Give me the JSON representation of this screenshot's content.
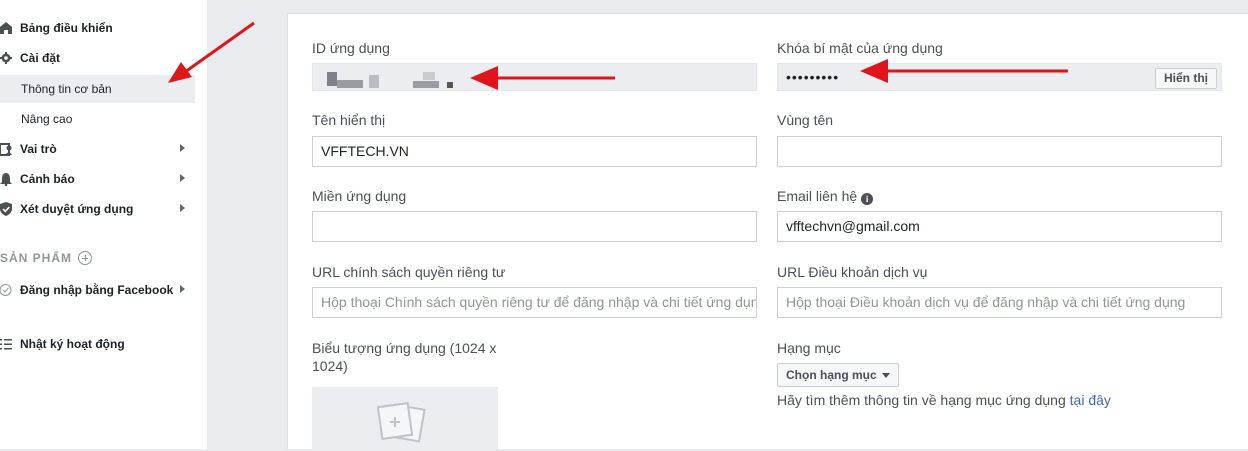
{
  "sidebar": {
    "items": [
      {
        "label": "Bảng điều khiển",
        "icon": "home-icon"
      },
      {
        "label": "Cài đặt",
        "icon": "gear-icon"
      },
      {
        "label": "Vai trò",
        "icon": "roles-icon"
      },
      {
        "label": "Cảnh báo",
        "icon": "bell-icon"
      },
      {
        "label": "Xét duyệt ứng dụng",
        "icon": "shield-check-icon"
      },
      {
        "label": "Đăng nhập bằng Facebook",
        "icon": "check-circle-icon"
      },
      {
        "label": "Nhật ký hoạt động",
        "icon": "list-icon"
      }
    ],
    "sub_items": [
      {
        "label": "Thông tin cơ bản",
        "active": true
      },
      {
        "label": "Nâng cao",
        "active": false
      }
    ],
    "section_products": "SẢN PHẨM"
  },
  "form": {
    "app_id": {
      "label": "ID ứng dụng",
      "value_hidden": true
    },
    "app_secret": {
      "label": "Khóa bí mật của ứng dụng",
      "value": "•••••••••",
      "reveal_label": "Hiển thị"
    },
    "display_name": {
      "label": "Tên hiển thị",
      "value": "VFFTECH.VN"
    },
    "namespace": {
      "label": "Vùng tên",
      "value": ""
    },
    "app_domains": {
      "label": "Miền ứng dụng",
      "value": ""
    },
    "contact_email": {
      "label": "Email liên hệ",
      "value": "vfftechvn@gmail.com"
    },
    "privacy_url": {
      "label": "URL chính sách quyền riêng tư",
      "placeholder": "Hộp thoại Chính sách quyền riêng tư để đăng nhập và chi tiết ứng dụng"
    },
    "tos_url": {
      "label": "URL Điều khoản dịch vụ",
      "placeholder": "Hộp thoại Điều khoản dịch vụ để đăng nhập và chi tiết ứng dụng"
    },
    "app_icon": {
      "label_line1": "Biểu tượng ứng dụng (1024 x",
      "label_line2": "1024)"
    },
    "category": {
      "label": "Hạng mục",
      "button": "Chọn hạng mục",
      "help": "Hãy tìm thêm thông tin về hạng mục ứng dụng ",
      "help_link": "tại đây"
    }
  },
  "colors": {
    "annotation_arrow": "#e0141b",
    "link": "#4267b2"
  }
}
